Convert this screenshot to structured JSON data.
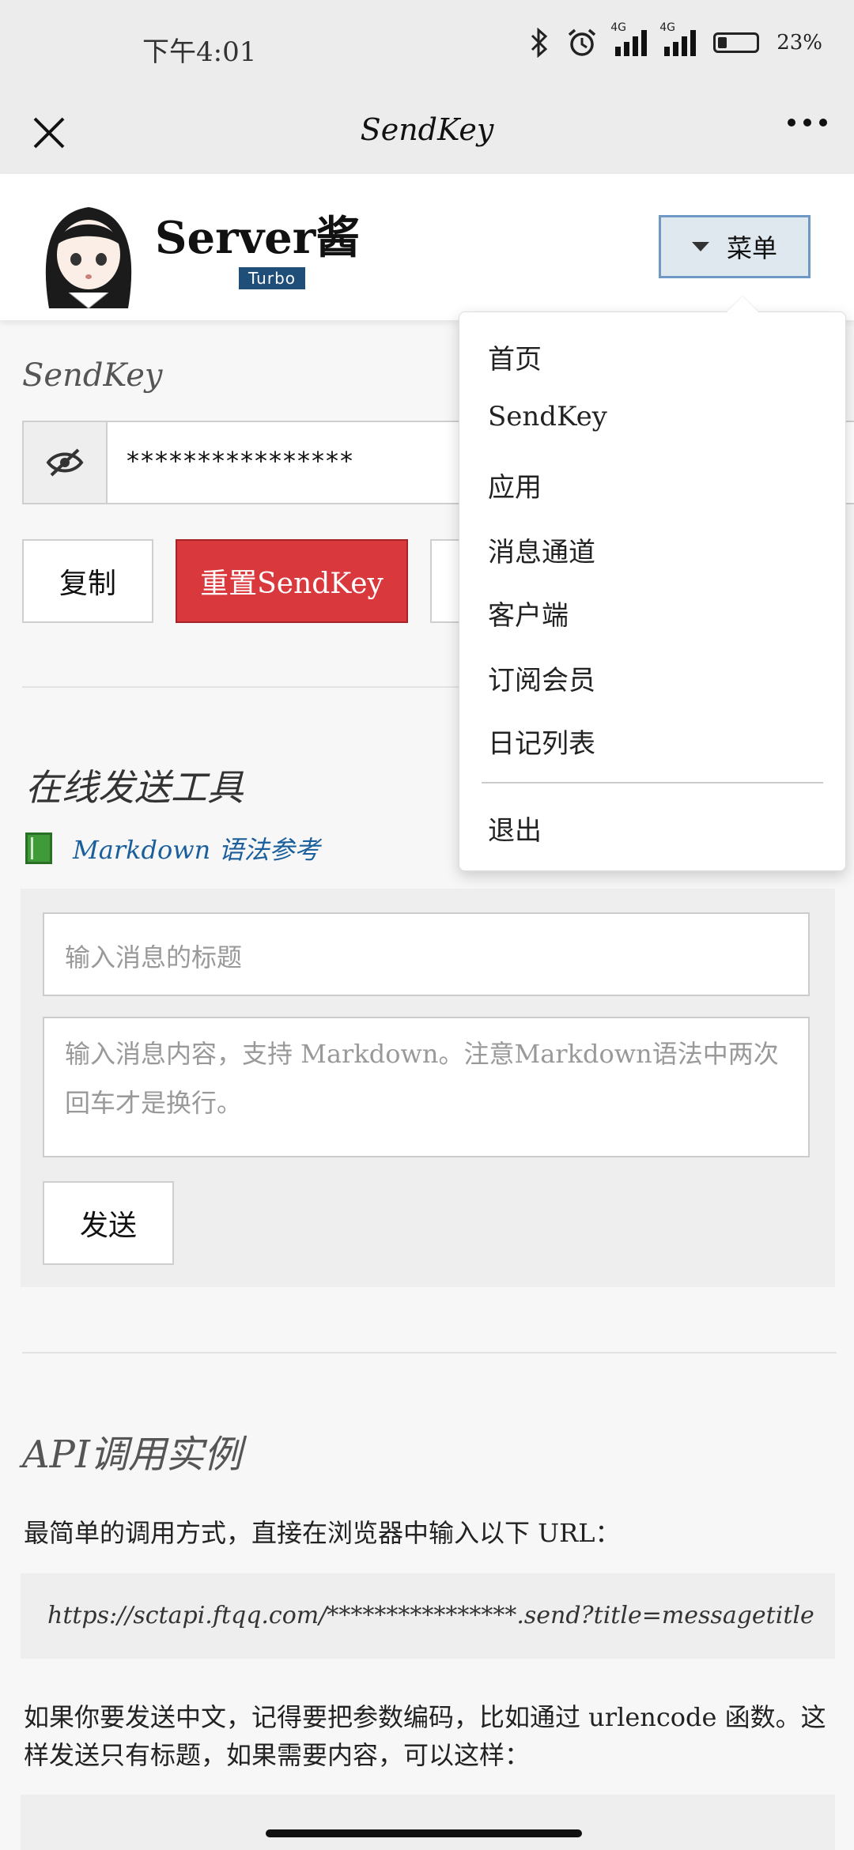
{
  "status_bar": {
    "time": "下午4:01",
    "network_1": "4G",
    "network_2": "4G",
    "battery_pct": "23%",
    "icons": [
      "bluetooth-icon",
      "alarm-icon",
      "signal-icon",
      "signal-icon",
      "battery-icon"
    ]
  },
  "nav": {
    "title": "SendKey",
    "close_icon": "close-icon",
    "more_icon": "more-icon"
  },
  "header": {
    "brand": "Server酱",
    "badge": "Turbo",
    "menu_label": "菜单"
  },
  "sendkey": {
    "title": "SendKey",
    "masked_key": "****************",
    "copy_label": "复制",
    "reset_label": "重置SendKey"
  },
  "tool": {
    "title": "在线发送工具",
    "markdown_link": "Markdown 语法参考",
    "title_placeholder": "输入消息的标题",
    "body_placeholder": "输入消息内容，支持 Markdown。注意Markdown语法中两次回车才是换行。",
    "send_label": "发送"
  },
  "api": {
    "title": "API调用实例",
    "desc1": "最简单的调用方式，直接在浏览器中输入以下 URL：",
    "url": "https://sctapi.ftqq.com/****************.send?title=messagetitle",
    "desc2": "如果你要发送中文，记得要把参数编码，比如通过 urlencode 函数。这样发送只有标题，如果需要内容，可以这样："
  },
  "dropdown": {
    "items": [
      "首页",
      "SendKey",
      "应用",
      "消息通道",
      "客户端",
      "订阅会员",
      "日记列表"
    ],
    "logout": "退出"
  },
  "colors": {
    "reset_button": "#d9393d",
    "turbo_badge": "#1f4e79",
    "link": "#1a5f9c",
    "menu_border": "#6d99c4"
  }
}
